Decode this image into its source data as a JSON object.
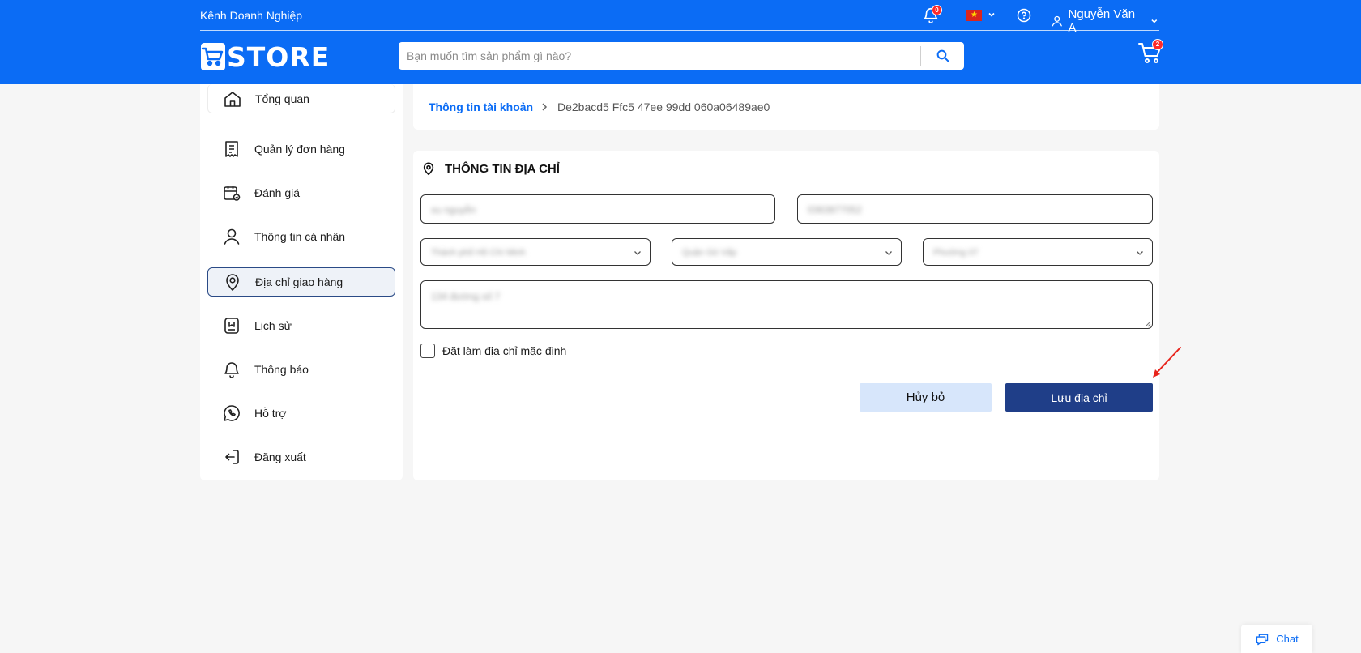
{
  "header": {
    "business_channel": "Kênh Doanh Nghiệp",
    "notification_count": "0",
    "language_flag": "vietnam-flag",
    "user_name": "Nguyễn Văn A",
    "logo_text": "STORE",
    "search_placeholder": "Bạn muốn tìm sản phẩm gì nào?",
    "cart_count": "2",
    "brand_color": "#0b6cf5"
  },
  "sidebar": {
    "items": [
      {
        "label": "Tổng quan",
        "icon": "home-icon"
      },
      {
        "label": "Quản lý đơn hàng",
        "icon": "receipt-icon"
      },
      {
        "label": "Đánh giá",
        "icon": "calendar-review-icon"
      },
      {
        "label": "Thông tin cá nhân",
        "icon": "user-icon"
      },
      {
        "label": "Địa chỉ giao hàng",
        "icon": "location-pin-icon",
        "active": true
      },
      {
        "label": "Lịch sử",
        "icon": "history-icon"
      },
      {
        "label": "Thông báo",
        "icon": "bell-icon"
      },
      {
        "label": "Hỗ trợ",
        "icon": "phone-support-icon"
      },
      {
        "label": "Đăng xuất",
        "icon": "logout-icon"
      }
    ]
  },
  "breadcrumb": {
    "parent": "Thông tin tài khoản",
    "current": "De2bacd5 Ffc5 47ee 99dd 060a06489ae0"
  },
  "form": {
    "title": "THÔNG TIN ĐỊA CHỈ",
    "name_value": "xu nguyễn",
    "phone_value": "0363877052",
    "city_value": "Thành phố Hồ Chí Minh",
    "district_value": "Quận Gò Vấp",
    "ward_value": "Phường 07",
    "address_value": "134 đường số 7",
    "default_checkbox_label": "Đặt làm địa chỉ mặc định",
    "default_checked": false,
    "cancel_label": "Hủy bỏ",
    "save_label": "Lưu địa chỉ",
    "save_color": "#1f3e88",
    "annotation_arrow_color": "#e8231b"
  },
  "chat": {
    "label": "Chat"
  }
}
